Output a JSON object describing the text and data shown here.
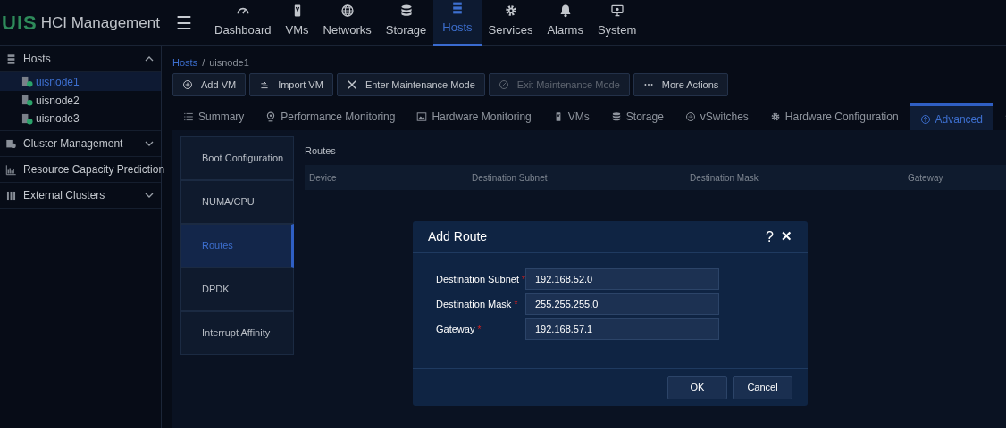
{
  "app": {
    "logo": "UIS",
    "title": "HCI Management",
    "menu_icon": "☰"
  },
  "nav": [
    {
      "label": "Dashboard",
      "selected": false
    },
    {
      "label": "VMs",
      "selected": false
    },
    {
      "label": "Networks",
      "selected": false
    },
    {
      "label": "Storage",
      "selected": false
    },
    {
      "label": "Hosts",
      "selected": true
    },
    {
      "label": "Services",
      "selected": false
    },
    {
      "label": "Alarms",
      "selected": false
    },
    {
      "label": "System",
      "selected": false
    }
  ],
  "sidebar": {
    "items": [
      {
        "label": "Hosts",
        "expanded": true,
        "children": [
          {
            "label": "uisnode1",
            "selected": true
          },
          {
            "label": "uisnode2",
            "selected": false
          },
          {
            "label": "uisnode3",
            "selected": false
          }
        ]
      },
      {
        "label": "Cluster Management",
        "expanded": false
      },
      {
        "label": "Resource Capacity Prediction"
      },
      {
        "label": "External Clusters",
        "expanded": false
      }
    ]
  },
  "breadcrumb": {
    "items": [
      "Hosts",
      "uisnode1"
    ],
    "separator": "/"
  },
  "toolbar": [
    {
      "label": "Add VM",
      "disabled": false
    },
    {
      "label": "Import VM",
      "disabled": false
    },
    {
      "label": "Enter Maintenance Mode",
      "disabled": false
    },
    {
      "label": "Exit Maintenance Mode",
      "disabled": true
    },
    {
      "label": "More Actions",
      "disabled": false
    }
  ],
  "tabs": [
    {
      "label": "Summary",
      "selected": false
    },
    {
      "label": "Performance Monitoring",
      "selected": false
    },
    {
      "label": "Hardware Monitoring",
      "selected": false
    },
    {
      "label": "VMs",
      "selected": false
    },
    {
      "label": "Storage",
      "selected": false
    },
    {
      "label": "vSwitches",
      "selected": false
    },
    {
      "label": "Hardware Configuration",
      "selected": false
    },
    {
      "label": "Advanced",
      "selected": true
    },
    {
      "selected": false
    }
  ],
  "advanced_menu": [
    {
      "label": "Boot Configuration",
      "selected": false
    },
    {
      "label": "NUMA/CPU",
      "selected": false
    },
    {
      "label": "Routes",
      "selected": true
    },
    {
      "label": "DPDK",
      "selected": false
    },
    {
      "label": "Interrupt Affinity",
      "selected": false
    }
  ],
  "routes": {
    "title": "Routes",
    "columns": [
      "Device",
      "Destination Subnet",
      "Destination Mask",
      "Gateway"
    ]
  },
  "dialog": {
    "title": "Add Route",
    "help": "?",
    "close": "✕",
    "fields": [
      {
        "label": "Destination Subnet",
        "required": true,
        "value": "192.168.52.0"
      },
      {
        "label": "Destination Mask",
        "required": true,
        "value": "255.255.255.0"
      },
      {
        "label": "Gateway",
        "required": true,
        "value": "192.168.57.1"
      }
    ],
    "buttons": [
      "OK",
      "Cancel"
    ],
    "required_mark": "*"
  }
}
